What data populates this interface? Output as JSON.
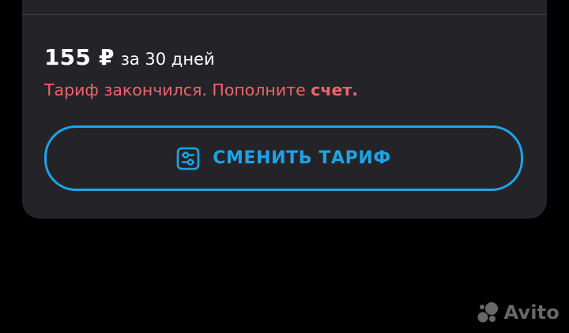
{
  "tariff": {
    "price": "155 ₽",
    "period": "за 30 дней",
    "status_text": "Тариф закончился. Пополните",
    "status_link": "счет."
  },
  "actions": {
    "change_tariff_label": "СМЕНИТЬ ТАРИФ",
    "change_tariff_icon": "settings-sliders-icon"
  },
  "watermark": {
    "text": "Avito"
  },
  "colors": {
    "background": "#000000",
    "card": "#242428",
    "accent": "#1ca4e8",
    "warning": "#f0646a",
    "text": "#ffffff"
  }
}
